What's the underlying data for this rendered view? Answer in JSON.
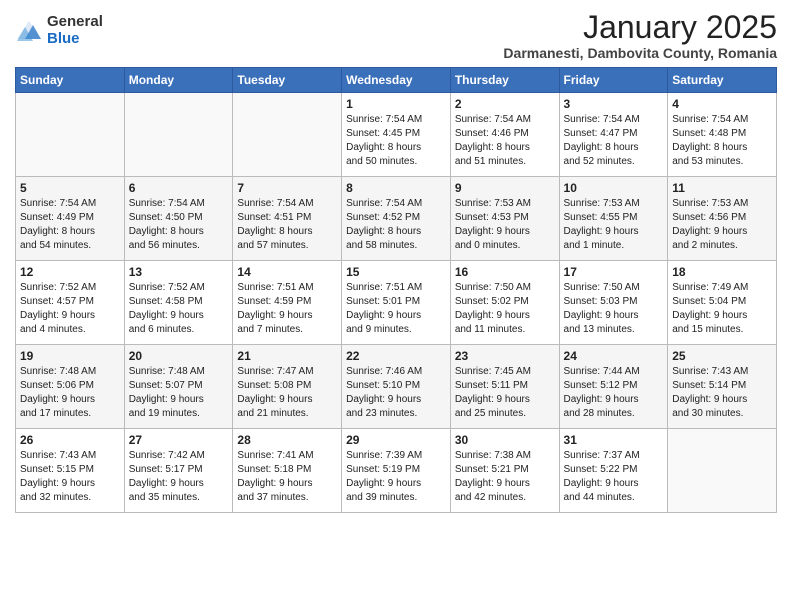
{
  "header": {
    "logo_general": "General",
    "logo_blue": "Blue",
    "month_title": "January 2025",
    "location": "Darmanesti, Dambovita County, Romania"
  },
  "days_of_week": [
    "Sunday",
    "Monday",
    "Tuesday",
    "Wednesday",
    "Thursday",
    "Friday",
    "Saturday"
  ],
  "weeks": [
    [
      {
        "day": "",
        "info": ""
      },
      {
        "day": "",
        "info": ""
      },
      {
        "day": "",
        "info": ""
      },
      {
        "day": "1",
        "info": "Sunrise: 7:54 AM\nSunset: 4:45 PM\nDaylight: 8 hours\nand 50 minutes."
      },
      {
        "day": "2",
        "info": "Sunrise: 7:54 AM\nSunset: 4:46 PM\nDaylight: 8 hours\nand 51 minutes."
      },
      {
        "day": "3",
        "info": "Sunrise: 7:54 AM\nSunset: 4:47 PM\nDaylight: 8 hours\nand 52 minutes."
      },
      {
        "day": "4",
        "info": "Sunrise: 7:54 AM\nSunset: 4:48 PM\nDaylight: 8 hours\nand 53 minutes."
      }
    ],
    [
      {
        "day": "5",
        "info": "Sunrise: 7:54 AM\nSunset: 4:49 PM\nDaylight: 8 hours\nand 54 minutes."
      },
      {
        "day": "6",
        "info": "Sunrise: 7:54 AM\nSunset: 4:50 PM\nDaylight: 8 hours\nand 56 minutes."
      },
      {
        "day": "7",
        "info": "Sunrise: 7:54 AM\nSunset: 4:51 PM\nDaylight: 8 hours\nand 57 minutes."
      },
      {
        "day": "8",
        "info": "Sunrise: 7:54 AM\nSunset: 4:52 PM\nDaylight: 8 hours\nand 58 minutes."
      },
      {
        "day": "9",
        "info": "Sunrise: 7:53 AM\nSunset: 4:53 PM\nDaylight: 9 hours\nand 0 minutes."
      },
      {
        "day": "10",
        "info": "Sunrise: 7:53 AM\nSunset: 4:55 PM\nDaylight: 9 hours\nand 1 minute."
      },
      {
        "day": "11",
        "info": "Sunrise: 7:53 AM\nSunset: 4:56 PM\nDaylight: 9 hours\nand 2 minutes."
      }
    ],
    [
      {
        "day": "12",
        "info": "Sunrise: 7:52 AM\nSunset: 4:57 PM\nDaylight: 9 hours\nand 4 minutes."
      },
      {
        "day": "13",
        "info": "Sunrise: 7:52 AM\nSunset: 4:58 PM\nDaylight: 9 hours\nand 6 minutes."
      },
      {
        "day": "14",
        "info": "Sunrise: 7:51 AM\nSunset: 4:59 PM\nDaylight: 9 hours\nand 7 minutes."
      },
      {
        "day": "15",
        "info": "Sunrise: 7:51 AM\nSunset: 5:01 PM\nDaylight: 9 hours\nand 9 minutes."
      },
      {
        "day": "16",
        "info": "Sunrise: 7:50 AM\nSunset: 5:02 PM\nDaylight: 9 hours\nand 11 minutes."
      },
      {
        "day": "17",
        "info": "Sunrise: 7:50 AM\nSunset: 5:03 PM\nDaylight: 9 hours\nand 13 minutes."
      },
      {
        "day": "18",
        "info": "Sunrise: 7:49 AM\nSunset: 5:04 PM\nDaylight: 9 hours\nand 15 minutes."
      }
    ],
    [
      {
        "day": "19",
        "info": "Sunrise: 7:48 AM\nSunset: 5:06 PM\nDaylight: 9 hours\nand 17 minutes."
      },
      {
        "day": "20",
        "info": "Sunrise: 7:48 AM\nSunset: 5:07 PM\nDaylight: 9 hours\nand 19 minutes."
      },
      {
        "day": "21",
        "info": "Sunrise: 7:47 AM\nSunset: 5:08 PM\nDaylight: 9 hours\nand 21 minutes."
      },
      {
        "day": "22",
        "info": "Sunrise: 7:46 AM\nSunset: 5:10 PM\nDaylight: 9 hours\nand 23 minutes."
      },
      {
        "day": "23",
        "info": "Sunrise: 7:45 AM\nSunset: 5:11 PM\nDaylight: 9 hours\nand 25 minutes."
      },
      {
        "day": "24",
        "info": "Sunrise: 7:44 AM\nSunset: 5:12 PM\nDaylight: 9 hours\nand 28 minutes."
      },
      {
        "day": "25",
        "info": "Sunrise: 7:43 AM\nSunset: 5:14 PM\nDaylight: 9 hours\nand 30 minutes."
      }
    ],
    [
      {
        "day": "26",
        "info": "Sunrise: 7:43 AM\nSunset: 5:15 PM\nDaylight: 9 hours\nand 32 minutes."
      },
      {
        "day": "27",
        "info": "Sunrise: 7:42 AM\nSunset: 5:17 PM\nDaylight: 9 hours\nand 35 minutes."
      },
      {
        "day": "28",
        "info": "Sunrise: 7:41 AM\nSunset: 5:18 PM\nDaylight: 9 hours\nand 37 minutes."
      },
      {
        "day": "29",
        "info": "Sunrise: 7:39 AM\nSunset: 5:19 PM\nDaylight: 9 hours\nand 39 minutes."
      },
      {
        "day": "30",
        "info": "Sunrise: 7:38 AM\nSunset: 5:21 PM\nDaylight: 9 hours\nand 42 minutes."
      },
      {
        "day": "31",
        "info": "Sunrise: 7:37 AM\nSunset: 5:22 PM\nDaylight: 9 hours\nand 44 minutes."
      },
      {
        "day": "",
        "info": ""
      }
    ]
  ]
}
